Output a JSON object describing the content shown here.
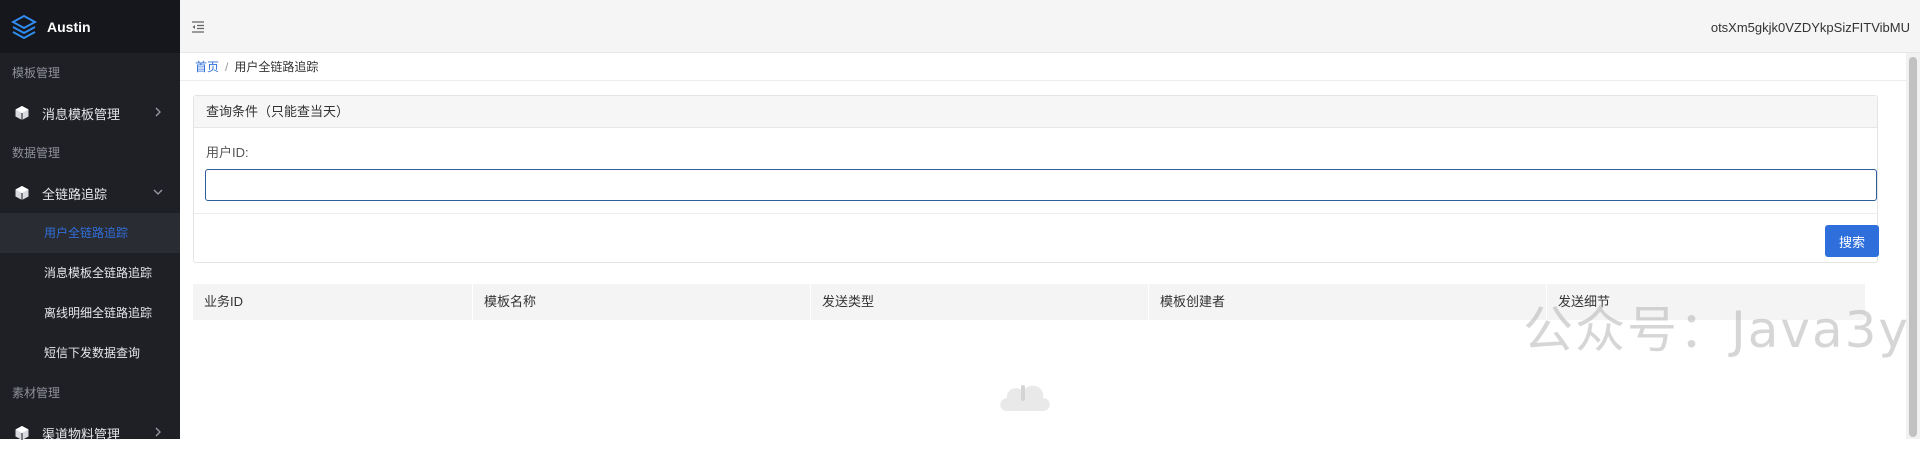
{
  "app": {
    "name": "Austin"
  },
  "sidebar": {
    "groups": [
      {
        "title": "模板管理"
      },
      {
        "title": "数据管理"
      },
      {
        "title": "素材管理"
      }
    ],
    "items": {
      "template_mgmt": "消息模板管理",
      "trace": "全链路追踪",
      "channel_material": "渠道物料管理"
    },
    "sub_items": [
      {
        "label": "用户全链路追踪"
      },
      {
        "label": "消息模板全链路追踪"
      },
      {
        "label": "离线明细全链路追踪"
      },
      {
        "label": "短信下发数据查询"
      }
    ]
  },
  "header": {
    "user": "otsXm5gkjk0VZDYkpSizFITVibMU"
  },
  "breadcrumb": {
    "home": "首页",
    "sep": "/",
    "current": "用户全链路追踪"
  },
  "query_panel": {
    "title": "查询条件（只能查当天）",
    "field_label": "用户ID:",
    "field_value": "",
    "search_label": "搜索"
  },
  "table": {
    "columns": [
      "业务ID",
      "模板名称",
      "发送类型",
      "模板创建者",
      "发送细节"
    ]
  },
  "watermark": "公众号：Java3y",
  "colors": {
    "accent": "#2f6fdc",
    "sidebar_bg": "#1f2026"
  }
}
